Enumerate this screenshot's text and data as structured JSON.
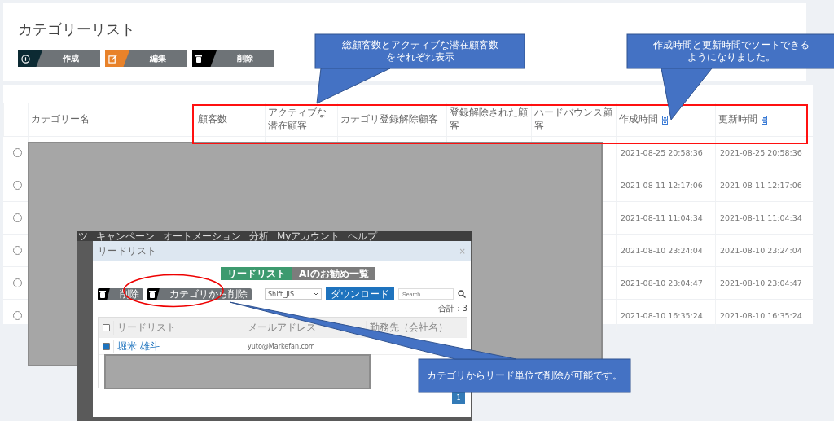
{
  "page_title": "カテゴリーリスト",
  "toolbar": [
    {
      "kind": "create",
      "label": "作成"
    },
    {
      "kind": "edit",
      "label": "編集"
    },
    {
      "kind": "delete",
      "label": "削除"
    }
  ],
  "table": {
    "columns": [
      {
        "label": "カテゴリー名",
        "sortable": false
      },
      {
        "label": "顧客数",
        "sortable": false
      },
      {
        "label": "アクティブな潜在顧客",
        "sortable": false
      },
      {
        "label": "カテゴリ登録解除顧客",
        "sortable": false
      },
      {
        "label": "登録解除された顧客",
        "sortable": false
      },
      {
        "label": "ハードバウンス顧客",
        "sortable": false
      },
      {
        "label": "作成時間",
        "sortable": true
      },
      {
        "label": "更新時間",
        "sortable": true
      }
    ],
    "rows": [
      {
        "selected": false,
        "created": "2021-08-25 20:58:36",
        "updated": "2021-08-25 20:58:36"
      },
      {
        "selected": false,
        "created": "2021-08-11 12:17:06",
        "updated": "2021-08-11 12:17:06"
      },
      {
        "selected": false,
        "created": "2021-08-11 11:04:34",
        "updated": "2021-08-11 11:04:34"
      },
      {
        "selected": false,
        "created": "2021-08-10 23:24:04",
        "updated": "2021-08-10 23:24:04"
      },
      {
        "selected": false,
        "created": "2021-08-10 23:04:47",
        "updated": "2021-08-10 23:04:47"
      },
      {
        "selected": false,
        "created": "2021-08-10 16:35:24",
        "updated": "2021-08-10 16:35:24"
      }
    ]
  },
  "inset": {
    "nav": [
      "ツ",
      "キャンペーン",
      "オートメーション",
      "分析",
      "Myアカウント",
      "ヘルプ"
    ],
    "modal": {
      "title": "リードリスト",
      "close": "×",
      "tabs": [
        {
          "label": "リードリスト",
          "selected": true
        },
        {
          "label": "AIのお勧め一覧",
          "selected": false
        }
      ],
      "buttons": [
        {
          "kind": "delete",
          "label": "削除"
        },
        {
          "kind": "delete",
          "label": "カテゴリから削除"
        }
      ],
      "encoding": "Shift_JIS",
      "download": "ダウンロード",
      "search": {
        "placeholder": "Search"
      },
      "total": "合計：3",
      "all_checked": false,
      "columns": [
        "リードリスト",
        "メールアドレス",
        "勤務先（会社名）"
      ],
      "rows": [
        {
          "checked": true,
          "name": "堀米 雄斗",
          "email": "yuto@Markefan.com"
        }
      ],
      "page": "1"
    }
  },
  "callouts": [
    {
      "text": "総顧客数とアクティブな潜在顧客数をそれぞれ表示"
    },
    {
      "text": "作成時間と更新時間でソートできるようになりました。"
    },
    {
      "text": "カテゴリからリード単位で削除が可能です。"
    }
  ]
}
